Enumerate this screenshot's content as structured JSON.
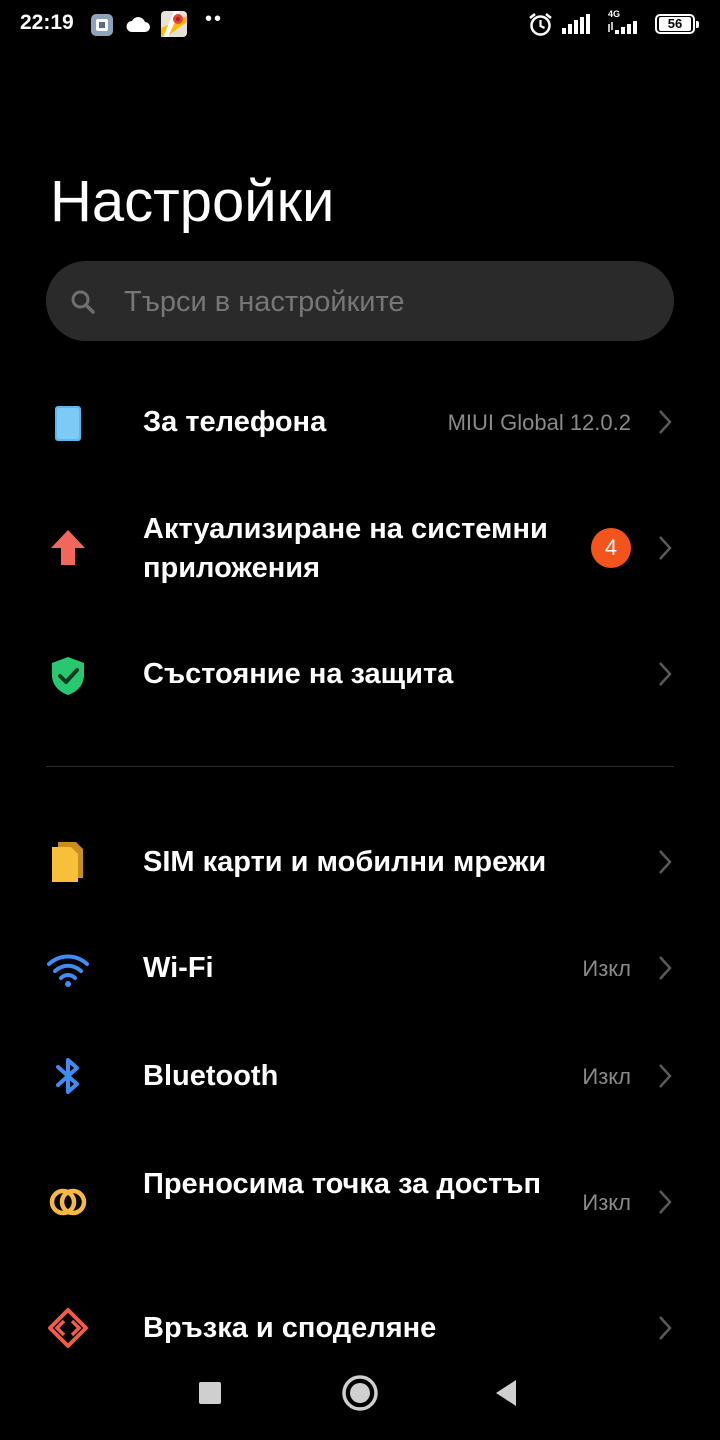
{
  "status_bar": {
    "time": "22:19",
    "dots": "••",
    "network_label": "4G",
    "battery": "56",
    "icons": [
      "gallery-icon",
      "cloud-icon",
      "maps-icon",
      "alarm-icon",
      "signal-icon",
      "signal-4g-icon",
      "battery-icon"
    ]
  },
  "page": {
    "title": "Настройки"
  },
  "search": {
    "placeholder": "Търси в настройките"
  },
  "items": [
    {
      "label": "За телефона",
      "value": "MIUI Global 12.0.2",
      "icon": "phone-icon",
      "icon_color": "#5ab8ee"
    },
    {
      "label": "Актуализиране на системни приложения",
      "badge": "4",
      "icon": "update-arrow-icon",
      "icon_color": "#f1675c"
    },
    {
      "label": "Състояние на защита",
      "icon": "shield-check-icon",
      "icon_color": "#29c76f"
    },
    {
      "label": "SIM карти и мобилни мрежи",
      "icon": "sim-card-icon",
      "icon_color": "#f7bf3a"
    },
    {
      "label": "Wi-Fi",
      "value": "Изкл",
      "icon": "wifi-icon",
      "icon_color": "#3f8cf2"
    },
    {
      "label": "Bluetooth",
      "value": "Изкл",
      "icon": "bluetooth-icon",
      "icon_color": "#3f8cf2"
    },
    {
      "label": "Преносима точка за достъп",
      "value": "Изкл",
      "icon": "hotspot-icon",
      "icon_color": "#f5b841"
    },
    {
      "label": "Връзка и споделяне",
      "icon": "connection-share-icon",
      "icon_color": "#ef5c4a"
    }
  ],
  "colors": {
    "background": "#000000",
    "badge": "#f2541b",
    "search_bg": "#2a2a2a",
    "secondary_text": "#8a8a8a"
  },
  "nav_bar": {
    "buttons": [
      "recents-button",
      "home-button",
      "back-button"
    ]
  }
}
